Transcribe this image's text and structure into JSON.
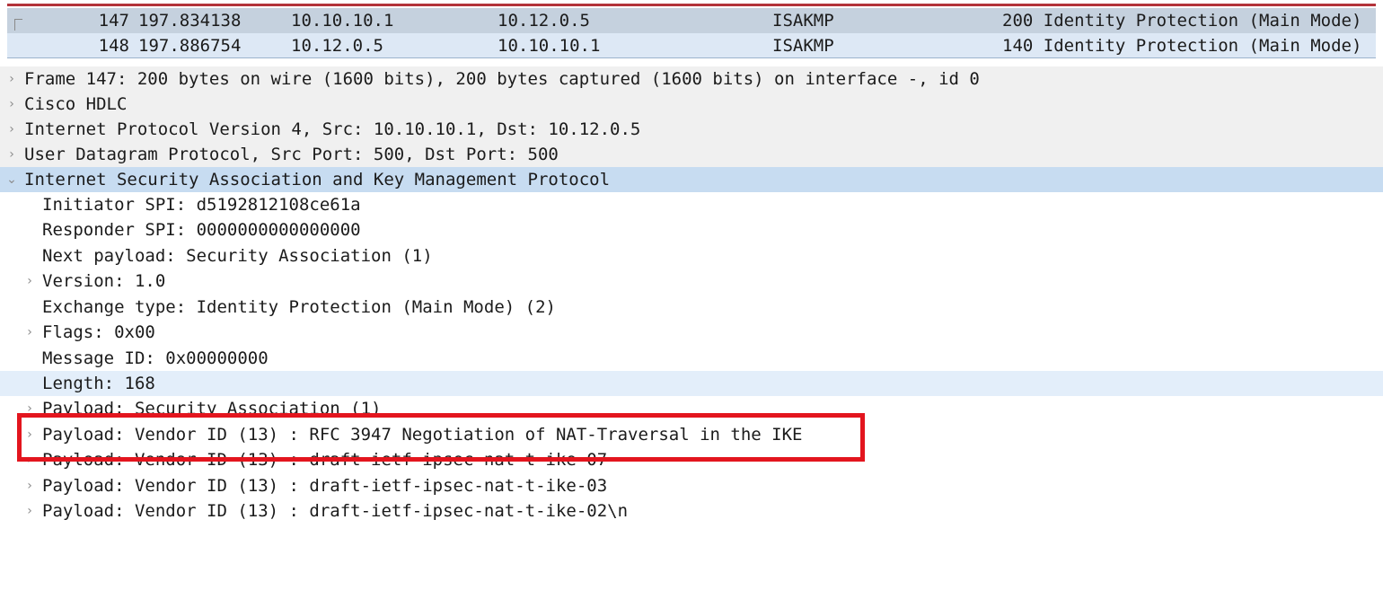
{
  "packet_list": [
    {
      "no": "147",
      "time": "197.834138",
      "source": "10.10.10.1",
      "destination": "10.12.0.5",
      "protocol": "ISAKMP",
      "length": "200",
      "info": "Identity Protection (Main Mode)"
    },
    {
      "no": "148",
      "time": "197.886754",
      "source": "10.12.0.5",
      "destination": "10.10.10.1",
      "protocol": "ISAKMP",
      "length": "140",
      "info": "Identity Protection (Main Mode)"
    }
  ],
  "details": {
    "frame": "Frame 147: 200 bytes on wire (1600 bits), 200 bytes captured (1600 bits) on interface -, id 0",
    "hdlc": "Cisco HDLC",
    "ipv4": "Internet Protocol Version 4, Src: 10.10.10.1, Dst: 10.12.0.5",
    "udp": "User Datagram Protocol, Src Port: 500, Dst Port: 500",
    "isakmp": "Internet Security Association and Key Management Protocol",
    "initiator_spi": "Initiator SPI: d5192812108ce61a",
    "responder_spi": "Responder SPI: 0000000000000000",
    "next_payload": "Next payload: Security Association (1)",
    "version": "Version: 1.0",
    "exchange_type": "Exchange type: Identity Protection (Main Mode) (2)",
    "flags": "Flags: 0x00",
    "message_id": "Message ID: 0x00000000",
    "length": "Length: 168",
    "payload_sa": "Payload: Security Association (1)",
    "payload_vid_rfc3947": "Payload: Vendor ID (13) : RFC 3947 Negotiation of NAT-Traversal in the IKE",
    "payload_vid_07": "Payload: Vendor ID (13) : draft-ietf-ipsec-nat-t-ike-07",
    "payload_vid_03": "Payload: Vendor ID (13) : draft-ietf-ipsec-nat-t-ike-03",
    "payload_vid_02": "Payload: Vendor ID (13) : draft-ietf-ipsec-nat-t-ike-02\\n"
  },
  "icons": {
    "collapsed": "›",
    "expanded": "⌄"
  },
  "colors": {
    "selected_row": "#c7dcf1",
    "annotation": "#e3151e"
  }
}
